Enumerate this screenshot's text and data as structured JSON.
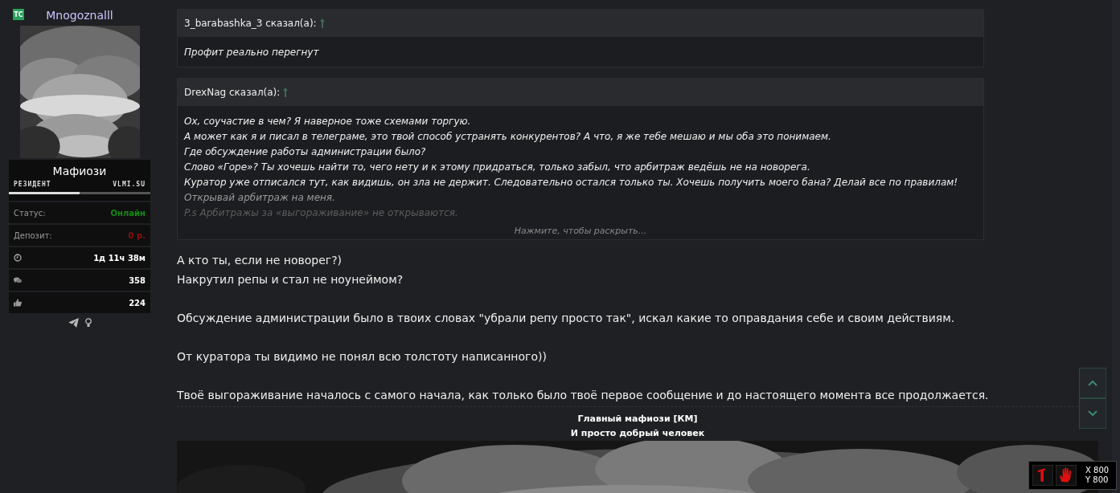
{
  "sidebar": {
    "badge": "TC",
    "username": "Mnogoznalll",
    "user_title": "Мафиози",
    "ranks": [
      {
        "label": "РЕЗИДЕНТ",
        "selected": true
      },
      {
        "label": "VLMI.SU",
        "selected": false
      }
    ],
    "stats": [
      {
        "kind": "label",
        "label": "Статус:",
        "value": "Онлайн",
        "color": "#138a13"
      },
      {
        "kind": "label",
        "label": "Депозит:",
        "value": "0 р.",
        "color": "#8a0f0f"
      },
      {
        "kind": "clock",
        "value": "1д 11ч 38м",
        "color": "#ffffff"
      },
      {
        "kind": "messages",
        "value": "358",
        "color": "#ffffff"
      },
      {
        "kind": "likes",
        "value": "224",
        "color": "#ffffff"
      }
    ]
  },
  "quotes": [
    {
      "author": "3_barabashka_3 сказал(а):",
      "lines": [
        "Профит реально перегнут"
      ],
      "collapsed": false
    },
    {
      "author": "DrexNag сказал(а):",
      "lines": [
        "Ох, соучастие в чем? Я наверное тоже схемами торгую.",
        "А может как я и писал в телеграме, это твой способ устранять конкурентов? А что, я же тебе мешаю и мы оба это понимаем.",
        "Где обсуждение работы администрации было?",
        "Слово «Горе»? Ты хочешь найти то, чего нету и к этому придраться, только забыл, что арбитраж ведёшь не на новорега.",
        "Куратор уже отписался тут, как видишь, он зла не держит. Следовательно остался только ты. Хочешь получить моего бана? Делай все по правилам!",
        "Открывай арбитраж на меня.",
        "P.s Арбитражы за «выгораживание» не открываются."
      ],
      "collapsed": true,
      "expand_label": "Нажмите, чтобы раскрыть..."
    }
  ],
  "post": [
    [
      "А кто ты, если не новорег?)",
      "Накрутил репы и стал не ноунеймом?"
    ],
    [
      "Обсуждение администрации было в твоих словах \"убрали репу просто так\", искал какие то оправдания себе и своим действиям."
    ],
    [
      "От куратора ты видимо не понял всю толстоту написанного))"
    ],
    [
      "Твоё выгораживание началось с самого начала, как только было твоё первое сообщение и до настоящего момента все продолжается."
    ]
  ],
  "signature": {
    "lines": [
      "Главный мафиози [КМ]",
      "И просто добрый человек"
    ]
  },
  "mouse_widget": {
    "x": "X 800",
    "y": "Y 800"
  }
}
